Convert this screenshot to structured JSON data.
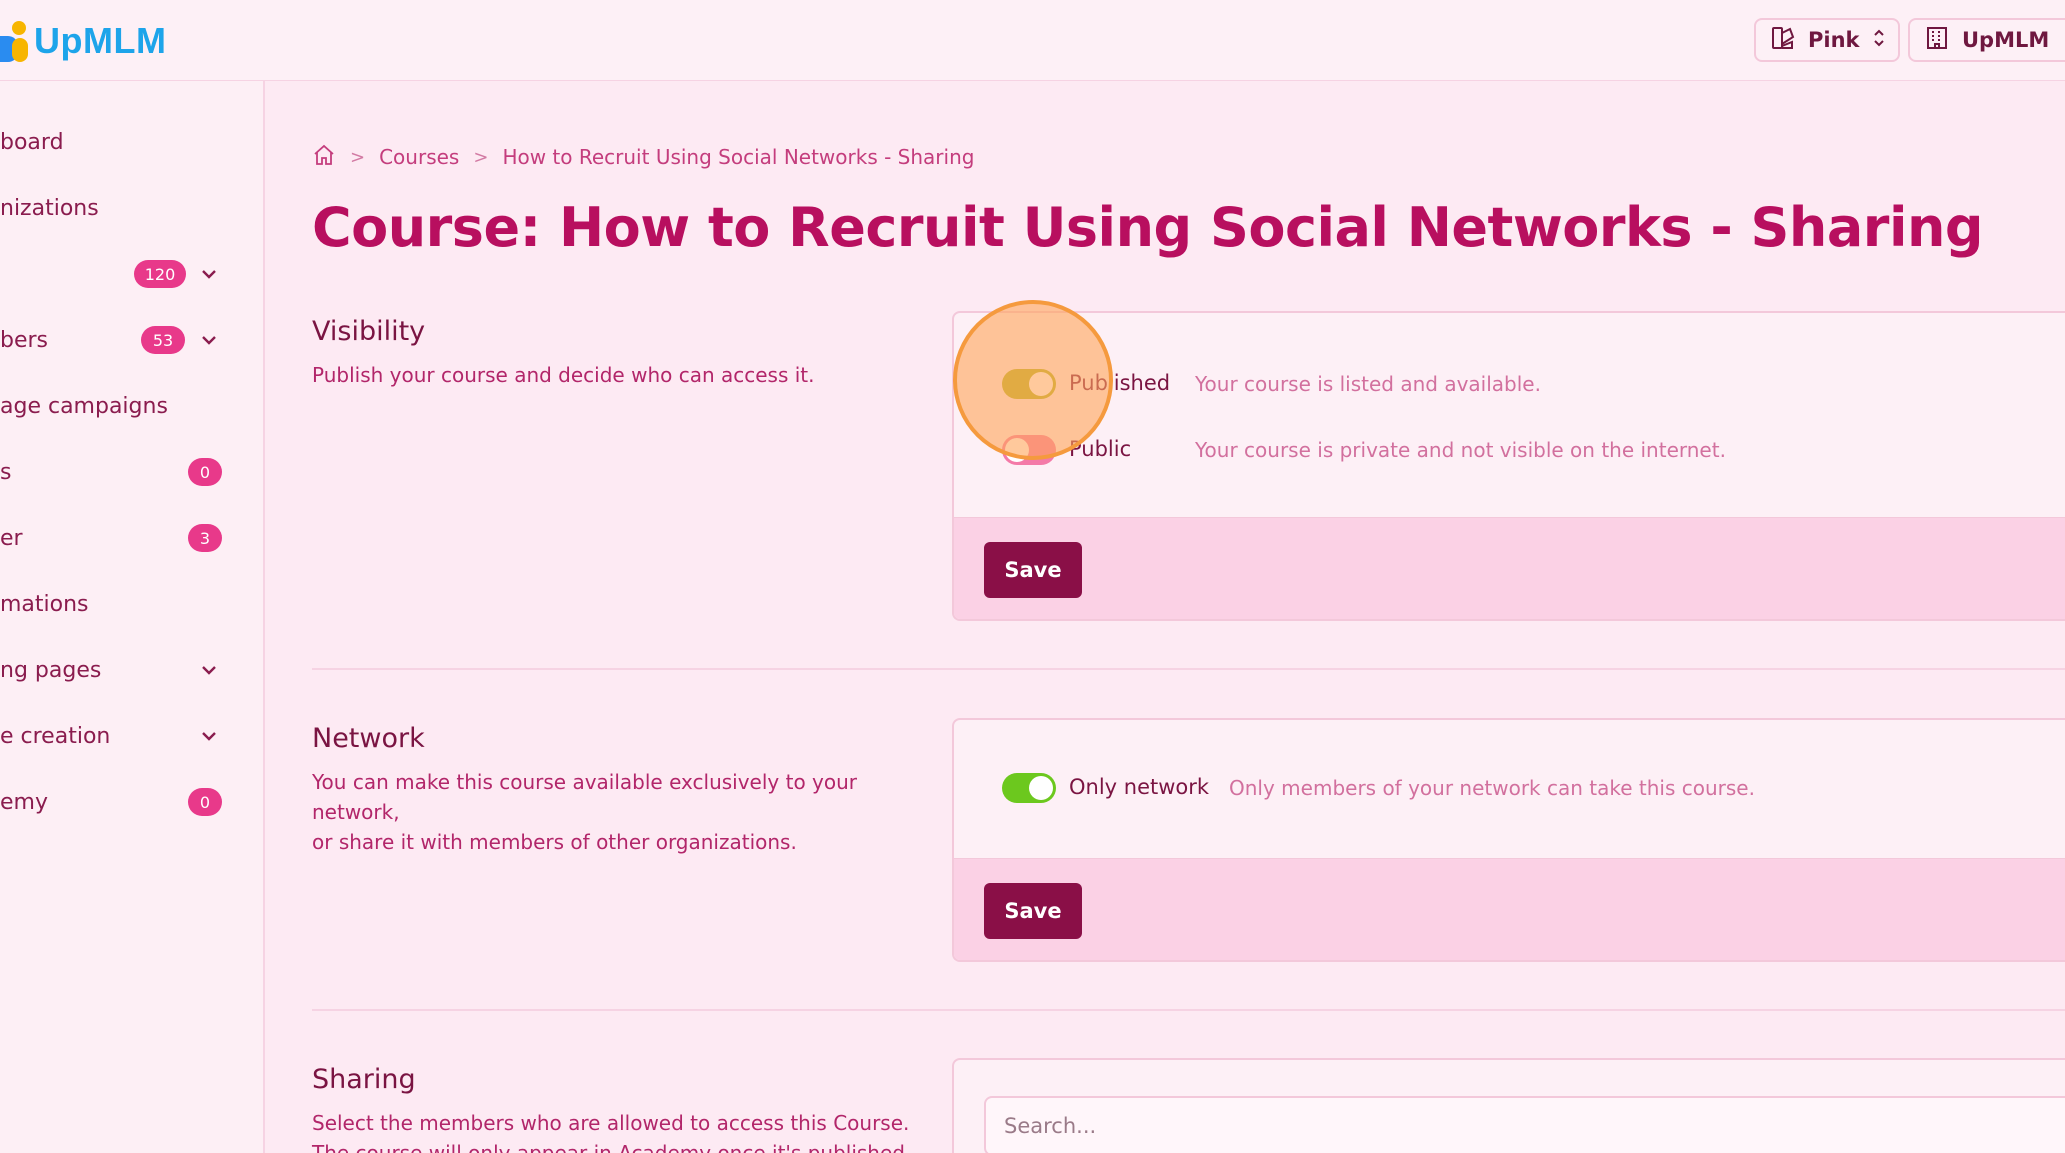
{
  "header": {
    "logo_text": "UpMLM",
    "theme_switch": "Pink",
    "org_switch": "UpMLM"
  },
  "sidebar": {
    "items": [
      {
        "label": "board"
      },
      {
        "label": "nizations"
      },
      {
        "label": "",
        "badge": "120",
        "expandable": true
      },
      {
        "label": "bers",
        "badge": "53",
        "expandable": true
      },
      {
        "label": "age campaigns"
      },
      {
        "label": "s",
        "badge": "0"
      },
      {
        "label": "er",
        "badge": "3"
      },
      {
        "label": "mations"
      },
      {
        "label": "ng pages",
        "expandable": true
      },
      {
        "label": "e creation",
        "expandable": true
      },
      {
        "label": "emy",
        "badge": "0"
      }
    ]
  },
  "breadcrumb": {
    "home_icon": "home-icon",
    "items": [
      "Courses",
      "How to Recruit Using Social Networks - Sharing"
    ]
  },
  "page": {
    "title": "Course: How to Recruit Using Social Networks - Sharing"
  },
  "visibility": {
    "title": "Visibility",
    "description": "Publish your course and decide who can access it.",
    "options": [
      {
        "label": "Published",
        "description": "Your course is listed and available.",
        "on": true
      },
      {
        "label": "Public",
        "description": "Your course is private and not visible on the internet.",
        "on": false
      }
    ],
    "save_label": "Save"
  },
  "network": {
    "title": "Network",
    "description_line1": "You can make this course available exclusively to your network,",
    "description_line2": "or share it with members of other organizations.",
    "option": {
      "label": "Only network",
      "description": "Only members of your network can take this course.",
      "on": true
    },
    "save_label": "Save"
  },
  "sharing": {
    "title": "Sharing",
    "description_line1": "Select the members who are allowed to access this Course.",
    "description_line2": "The course will only appear in Academy once it's published",
    "search_placeholder": "Search..."
  },
  "colors": {
    "accent": "#b80f5f",
    "toggle_on_green": "#6cc81e",
    "toggle_on_olive": "#b5b422",
    "toggle_off": "#f47aa8",
    "save_button": "#8a0f47",
    "badge": "#e8398a"
  }
}
